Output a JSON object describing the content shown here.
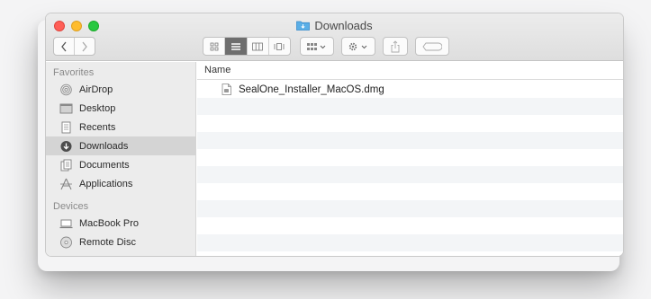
{
  "window": {
    "title": "Downloads",
    "accent_color": "#4aa3df",
    "selected_color": "#d4d4d4"
  },
  "toolbar": {
    "back_icon": "chevron-left-icon",
    "forward_icon": "chevron-right-icon",
    "view_modes": [
      "icon-view",
      "list-view",
      "column-view",
      "cover-flow-view"
    ],
    "active_view": "list-view",
    "group_icon": "group-by-icon",
    "action_icon": "gear-icon",
    "share_icon": "share-icon",
    "tag_icon": "tag-icon"
  },
  "sidebar": {
    "favorites_header": "Favorites",
    "favorites": [
      {
        "label": "AirDrop",
        "icon": "airdrop-icon"
      },
      {
        "label": "Desktop",
        "icon": "desktop-icon"
      },
      {
        "label": "Recents",
        "icon": "recents-icon"
      },
      {
        "label": "Downloads",
        "icon": "downloads-icon",
        "selected": true
      },
      {
        "label": "Documents",
        "icon": "documents-icon"
      },
      {
        "label": "Applications",
        "icon": "applications-icon"
      }
    ],
    "devices_header": "Devices",
    "devices": [
      {
        "label": "MacBook Pro",
        "icon": "laptop-icon"
      },
      {
        "label": "Remote Disc",
        "icon": "disc-icon"
      }
    ]
  },
  "content": {
    "column_header": "Name",
    "files": [
      {
        "name": "SealOne_Installer_MacOS.dmg",
        "icon": "disk-image-icon"
      }
    ]
  }
}
